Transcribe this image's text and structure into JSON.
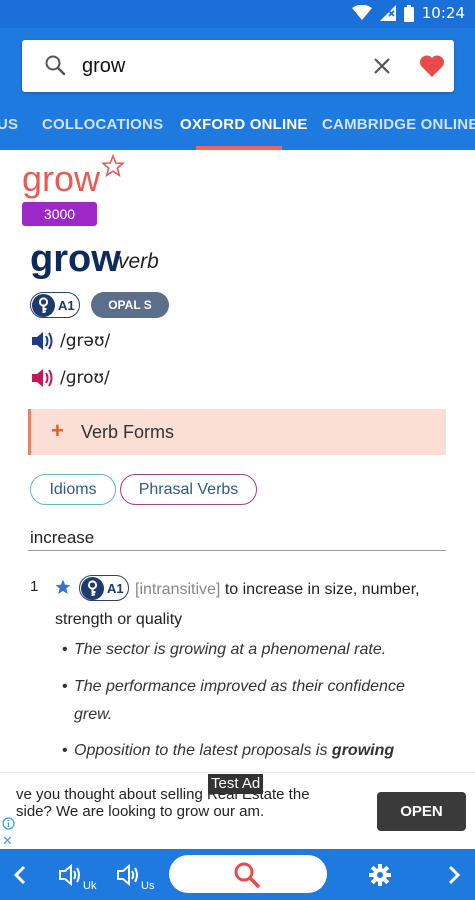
{
  "status_bar": {
    "time": "10:24",
    "icons": [
      "wifi-icon",
      "signal-icon",
      "battery-icon"
    ]
  },
  "search": {
    "value": "grow",
    "icons": [
      "search-icon",
      "close-icon",
      "heart-icon"
    ],
    "heart_color": "#e94b4b"
  },
  "tabs": [
    {
      "label": "US",
      "active": false
    },
    {
      "label": "COLLOCATIONS",
      "active": false
    },
    {
      "label": "OXFORD ONLINE",
      "active": true
    },
    {
      "label": "CAMBRIDGE ONLINE",
      "active": false
    }
  ],
  "entry": {
    "headword_top": "grow",
    "frequency_badge": "3000",
    "headword": "grow",
    "part_of_speech": "verb",
    "level_badge": "A1",
    "opal_badge": "OPAL S",
    "pron_uk": "/grəʊ/",
    "pron_us": "/ɡroʊ/",
    "verb_forms_label": "Verb Forms",
    "links": [
      "Idioms",
      "Phrasal Verbs"
    ],
    "shortcut": "increase",
    "senses": [
      {
        "number": "1",
        "level": "A1",
        "grammar": "[intransitive]",
        "definition": "to increase in size, number, strength or quality",
        "examples": [
          {
            "text": "The sector is growing at a phenomenal rate."
          },
          {
            "text": "The performance improved as their confidence grew."
          },
          {
            "text_before": "Opposition to the latest proposals is ",
            "text_bold": "growing"
          }
        ]
      }
    ]
  },
  "ad": {
    "label": "Test Ad",
    "text": "ve you thought about selling Real Estate the side? We are looking to grow our am.",
    "button": "OPEN"
  },
  "bottom_bar": {
    "back": "back-chevron-icon",
    "speaker_uk_label": "Uk",
    "speaker_us_label": "Us",
    "search": "search-icon",
    "settings": "gear-icon",
    "forward": "forward-chevron-icon"
  },
  "colors": {
    "primary": "#1f7ae0",
    "accent_red": "#e85a55",
    "badge_purple": "#9b28c7",
    "verb_forms_bg": "#fbdfd6"
  }
}
